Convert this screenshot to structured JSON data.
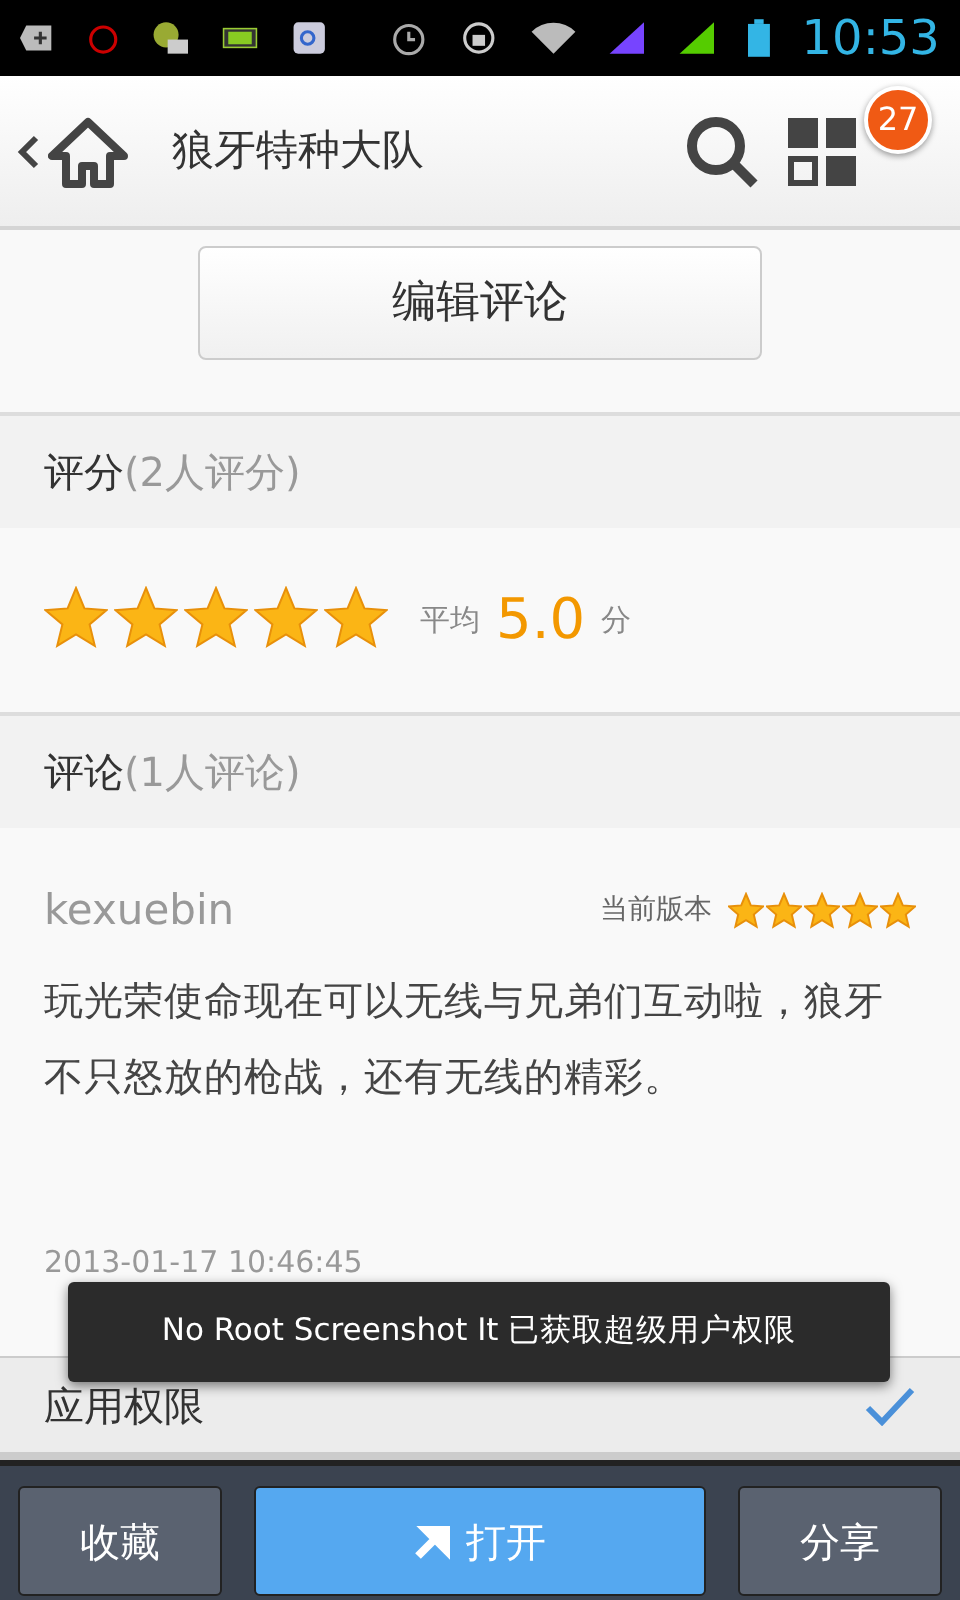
{
  "status_bar": {
    "time": "10:53"
  },
  "header": {
    "title": "狼牙特种大队",
    "badge": "27"
  },
  "edit_button": "编辑评论",
  "rating_section": {
    "label": "评分",
    "count": "(2人评分)",
    "stars": 5,
    "average_label": "平均",
    "average": "5.0",
    "unit": "分"
  },
  "review_section": {
    "label": "评论",
    "count": "(1人评论)"
  },
  "reviews": [
    {
      "user": "kexuebin",
      "version": "当前版本",
      "stars": 5,
      "text": "玩光荣使命现在可以无线与兄弟们互动啦，狼牙不只怒放的枪战，还有无线的精彩。",
      "date": "2013-01-17 10:46:45"
    }
  ],
  "permissions": {
    "label": "应用权限",
    "expanded": true
  },
  "toast": "No Root Screenshot It 已获取超级用户权限",
  "bottom_buttons": [
    {
      "label": "收藏",
      "kind": "plain"
    },
    {
      "label": "打开",
      "kind": "primary"
    },
    {
      "label": "分享",
      "kind": "plain"
    }
  ]
}
